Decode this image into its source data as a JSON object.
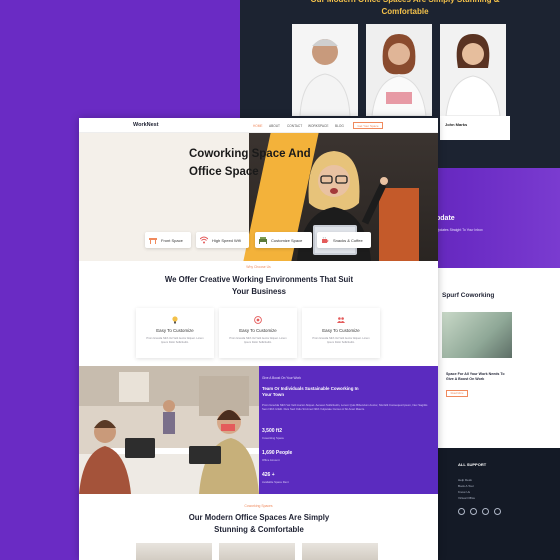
{
  "back_page": {
    "team_title": "Our Modern Office Spaces Are Simply Stunning & Comfortable",
    "member_name": "John Marks",
    "update_heading": "pdate",
    "update_subtext": "Updates Straight To Your Inbox",
    "blog_heading": "Spurf Coworking",
    "blog_post_title": "Space For All Your Work Needs To Give A Boost On Work",
    "blog_button": "Read More",
    "footer_heading": "ALL SUPPORT",
    "footer_links": [
      "Help Desk",
      "Book A Tour",
      "Know Us",
      "Virtual Office"
    ]
  },
  "nav": {
    "logo": "WorkNest",
    "items": [
      "HOME",
      "ABOUT",
      "CONTACT",
      "WORKSPACE",
      "BLOG"
    ],
    "cta": "Get Your Space"
  },
  "hero": {
    "title_line1": "Coworking Space And",
    "title_line2": "Office Space",
    "features": [
      "Front Space",
      "High Speed Wifi",
      "Customize Space",
      "Snacks & Coffee"
    ]
  },
  "offer": {
    "eyebrow": "Why Choose Us",
    "title": "We Offer Creative Working Environments That Suit Your Business",
    "cards": [
      {
        "title": "Easy To Customize",
        "desc": "Proin Gravida Nibh Vel Velit Auctor Aliquet. Lorem Ipsum Dolor Sollicitudin."
      },
      {
        "title": "Easy To Customize",
        "desc": "Proin Gravida Nibh Vel Velit Auctor Aliquet. Lorem Ipsum Dolor Sollicitudin."
      },
      {
        "title": "Easy To Customize",
        "desc": "Proin Gravida Nibh Vel Velit Auctor Aliquet. Lorem Ipsum Dolor Sollicitudin."
      }
    ]
  },
  "about": {
    "eyebrow": "Give A Boost On Your Work",
    "heading": "Team Or Individuals Sustainable Coworking In Your Town",
    "body": "Proin Gravida Nibh Vel Velit Auctor Aliquet. Aenean Sollicitudin, Lorem Quis Bibendum Auctor, Nisi Elit Consequat Ipsum, Nec Sagittis Sem Nibh Id Elit. Duis Sed Odio Sit Amet Nibh Vulputate Cursus A Sit Amet Mauris.",
    "stats": [
      {
        "value": "3,500 ft2",
        "label": "Coworking Space"
      },
      {
        "value": "1,690 People",
        "label": "Office Amount"
      },
      {
        "value": "426 +",
        "label": "Available Space Rent"
      }
    ]
  },
  "offices": {
    "eyebrow": "Coworking Spaces",
    "title_line1": "Our Modern Office Spaces Are Simply",
    "title_line2": "Stunning & Comfortable"
  }
}
